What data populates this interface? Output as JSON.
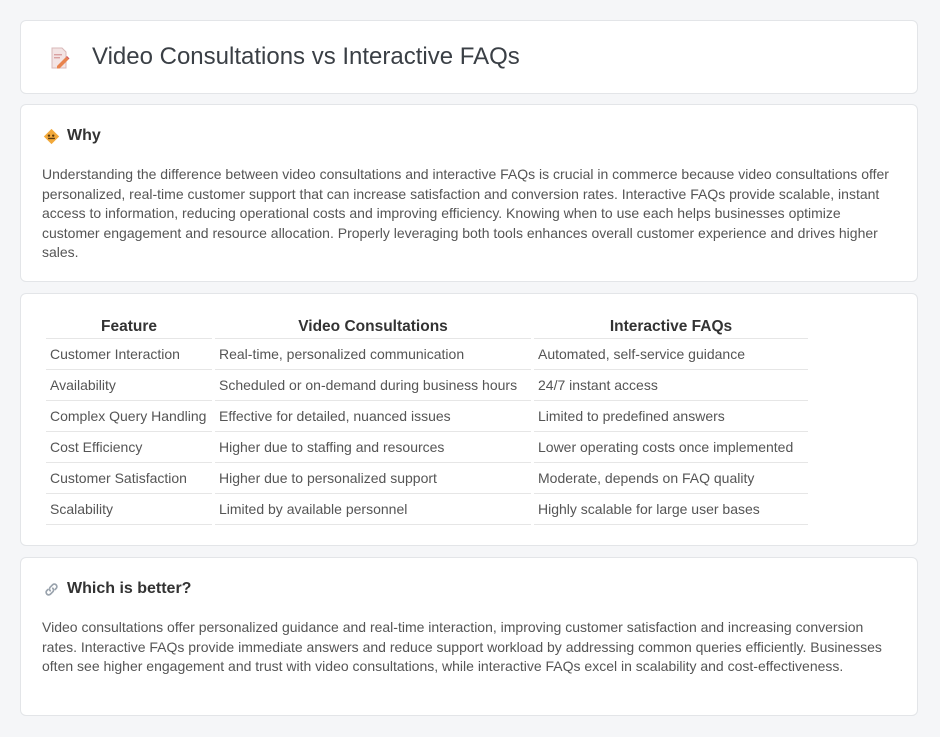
{
  "header": {
    "title": "Video Consultations vs Interactive FAQs"
  },
  "why": {
    "heading": "Why",
    "text": "Understanding the difference between video consultations and interactive FAQs is crucial in commerce because video consultations offer personalized, real-time customer support that can increase satisfaction and conversion rates. Interactive FAQs provide scalable, instant access to information, reducing operational costs and improving efficiency. Knowing when to use each helps businesses optimize customer engagement and resource allocation. Properly leveraging both tools enhances overall customer experience and drives higher sales."
  },
  "table": {
    "headers": [
      "Feature",
      "Video Consultations",
      "Interactive FAQs"
    ],
    "rows": [
      [
        "Customer Interaction",
        "Real-time, personalized communication",
        "Automated, self-service guidance"
      ],
      [
        "Availability",
        "Scheduled or on-demand during business hours",
        "24/7 instant access"
      ],
      [
        "Complex Query Handling",
        "Effective for detailed, nuanced issues",
        "Limited to predefined answers"
      ],
      [
        "Cost Efficiency",
        "Higher due to staffing and resources",
        "Lower operating costs once implemented"
      ],
      [
        "Customer Satisfaction",
        "Higher due to personalized support",
        "Moderate, depends on FAQ quality"
      ],
      [
        "Scalability",
        "Limited by available personnel",
        "Highly scalable for large user bases"
      ]
    ]
  },
  "better": {
    "heading": "Which is better?",
    "text": "Video consultations offer personalized guidance and real-time interaction, improving customer satisfaction and increasing conversion rates. Interactive FAQs provide immediate answers and reduce support workload by addressing common queries efficiently. Businesses often see higher engagement and trust with video consultations, while interactive FAQs excel in scalability and cost-effectiveness."
  },
  "icons": {
    "title": "document-pencil-icon",
    "why": "warning-sign-icon",
    "better": "link-icon"
  }
}
